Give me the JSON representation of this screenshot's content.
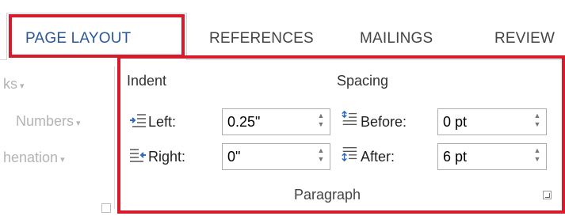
{
  "tabs": [
    {
      "label": "PAGE LAYOUT",
      "active": true
    },
    {
      "label": "REFERENCES",
      "active": false
    },
    {
      "label": "MAILINGS",
      "active": false
    },
    {
      "label": "REVIEW",
      "active": false
    }
  ],
  "left_group": {
    "items": [
      "ks",
      "Numbers",
      "henation"
    ]
  },
  "paragraph_group": {
    "title": "Paragraph",
    "indent": {
      "heading": "Indent",
      "left_label": "Left:",
      "left_value": "0.25\"",
      "right_label": "Right:",
      "right_value": "0\""
    },
    "spacing": {
      "heading": "Spacing",
      "before_label": "Before:",
      "before_value": "0 pt",
      "after_label": "After:",
      "after_value": "6 pt"
    }
  },
  "colors": {
    "highlight": "#d81b2a",
    "active_tab_text": "#2b579a",
    "icon_blue": "#2e6bbd"
  }
}
